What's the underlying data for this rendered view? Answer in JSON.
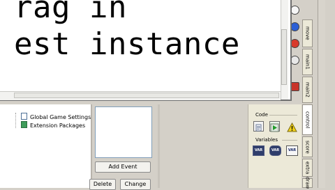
{
  "editor": {
    "lines": [
      "rag in",
      "est instance"
    ]
  },
  "tree": {
    "items": [
      {
        "label": "Global Game Settings",
        "icon": "checklist-icon"
      },
      {
        "label": "Extension Packages",
        "icon": "puzzle-icon"
      }
    ]
  },
  "events": {
    "add_event_label": "Add Event",
    "delete_label": "Delete",
    "change_label": "Change"
  },
  "actions": {
    "code_group_label": "Code",
    "variables_group_label": "Variables",
    "var_icon_text": "VAR"
  },
  "tabs": [
    {
      "label": "move",
      "active": false
    },
    {
      "label": "main1",
      "active": false
    },
    {
      "label": "main2",
      "active": false
    },
    {
      "label": "control",
      "active": true
    },
    {
      "label": "score",
      "active": false
    },
    {
      "label": "extra",
      "active": false
    },
    {
      "label": "draw",
      "active": false
    }
  ],
  "colors": {
    "panel": "#d4d0c8",
    "action_panel": "#ece9d8",
    "var_icon": "#2f3d6b",
    "play_green": "#1f9a2a",
    "warning_yellow": "#f2d21a"
  }
}
